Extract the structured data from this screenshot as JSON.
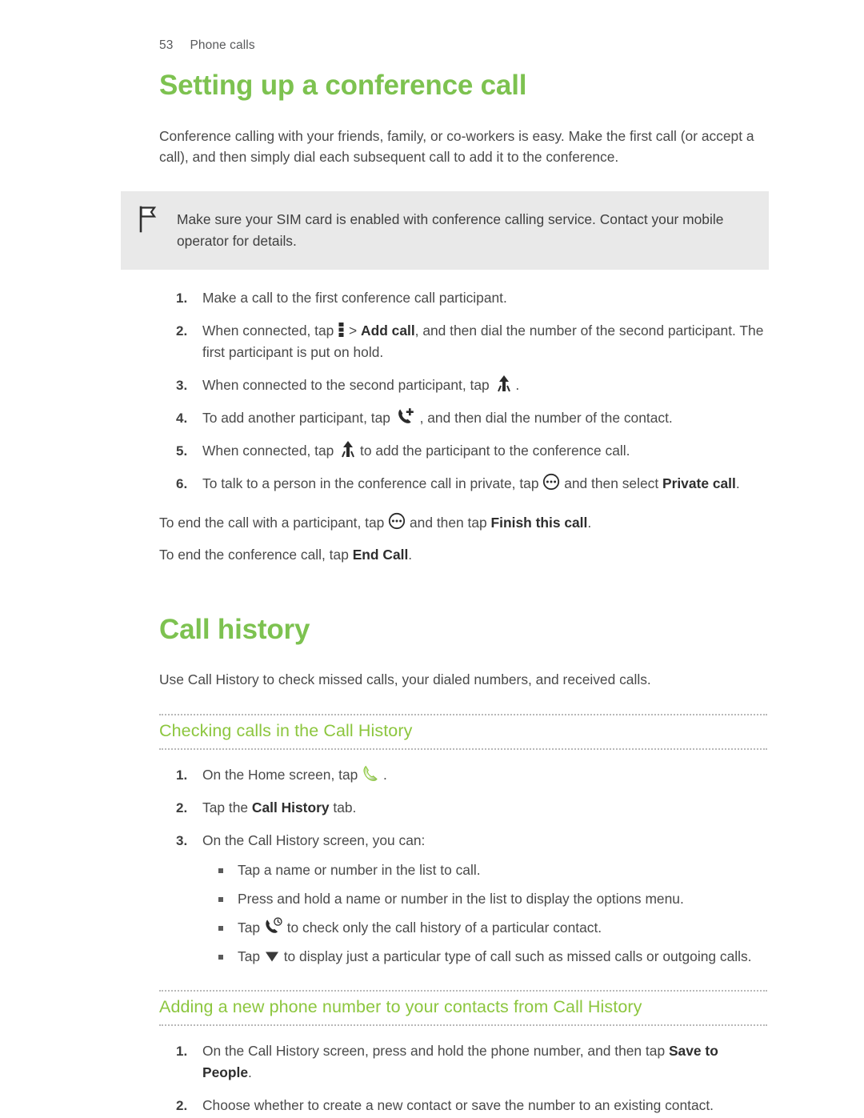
{
  "header": {
    "page_number": "53",
    "section": "Phone calls"
  },
  "colors": {
    "accent_green": "#7DC250",
    "subhead_green": "#8CC63E",
    "body_text": "#4A4A4A",
    "note_background": "#E9E9E9"
  },
  "section1": {
    "title": "Setting up a conference call",
    "intro": "Conference calling with your friends, family, or co-workers is easy. Make the first call (or accept a call), and then simply dial each subsequent call to add it to the conference.",
    "note": "Make sure your SIM card is enabled with conference calling service. Contact your mobile operator for details.",
    "note_icon": "flag-icon",
    "steps": [
      {
        "text_before": "Make a call to the first conference call participant.",
        "icon": null,
        "bold": "",
        "text_after": ""
      },
      {
        "text_before": "When connected, tap ",
        "icon": "overflow-menu-icon",
        "mid": " > ",
        "bold": "Add call",
        "text_after": ", and then dial the number of the second participant. The first participant is put on hold."
      },
      {
        "text_before": "When connected to the second participant, tap ",
        "icon": "merge-call-icon",
        "mid": "",
        "bold": "",
        "text_after": " ."
      },
      {
        "text_before": "To add another participant, tap ",
        "icon": "add-call-icon",
        "mid": "",
        "bold": "",
        "text_after": " , and then dial the number of the contact."
      },
      {
        "text_before": "When connected, tap ",
        "icon": "merge-call-icon",
        "mid": "",
        "bold": "",
        "text_after": " to add the participant to the conference call."
      },
      {
        "text_before": "To talk to a person in the conference call in private, tap ",
        "icon": "circle-dots-icon",
        "mid": " and then select ",
        "bold": "Private call",
        "text_after": "."
      }
    ],
    "closing": [
      {
        "text_before": "To end the call with a participant, tap ",
        "icon": "circle-dots-icon",
        "mid": " and then tap ",
        "bold": "Finish this call",
        "text_after": "."
      },
      {
        "text_before": "To end the conference call, tap ",
        "icon": null,
        "mid": "",
        "bold": "End Call",
        "text_after": "."
      }
    ]
  },
  "section2": {
    "title": "Call history",
    "intro": "Use Call History to check missed calls, your dialed numbers, and received calls.",
    "subsection1": {
      "heading": "Checking calls in the Call History",
      "steps": [
        {
          "text_before": "On the Home screen, tap ",
          "icon": "phone-handset-icon",
          "mid": "",
          "bold": "",
          "text_after": " ."
        },
        {
          "text_before": "Tap the ",
          "icon": null,
          "mid": "",
          "bold": "Call History",
          "text_after": " tab."
        },
        {
          "text_before": "On the Call History screen, you can:",
          "icon": null,
          "mid": "",
          "bold": "",
          "text_after": ""
        }
      ],
      "bullets": [
        {
          "text_before": "Tap a name or number in the list to call.",
          "icon": null,
          "text_after": ""
        },
        {
          "text_before": "Press and hold a name or number in the list to display the options menu.",
          "icon": null,
          "text_after": ""
        },
        {
          "text_before": "Tap ",
          "icon": "call-history-icon",
          "text_after": " to check only the call history of a particular contact."
        },
        {
          "text_before": "Tap ",
          "icon": "filter-triangle-icon",
          "text_after": " to display just a particular type of call such as missed calls or outgoing calls."
        }
      ]
    },
    "subsection2": {
      "heading": "Adding a new phone number to your contacts from Call History",
      "steps": [
        {
          "text_before": "On the Call History screen, press and hold the phone number, and then tap ",
          "icon": null,
          "mid": "",
          "bold": "Save to People",
          "text_after": "."
        },
        {
          "text_before": "Choose whether to create a new contact or save the number to an existing contact.",
          "icon": null,
          "mid": "",
          "bold": "",
          "text_after": ""
        }
      ]
    }
  }
}
